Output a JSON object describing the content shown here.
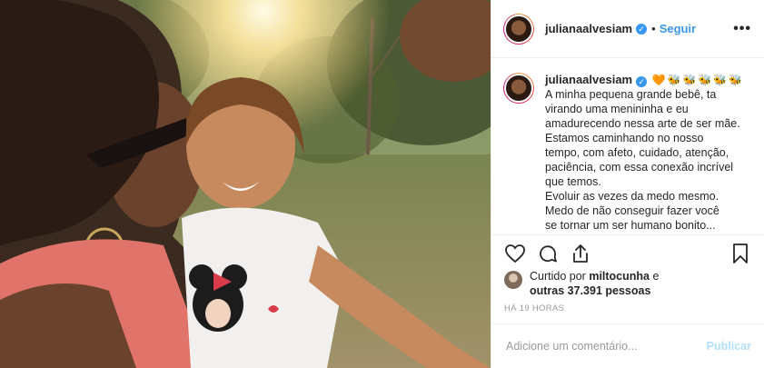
{
  "photo": {
    "alt": ""
  },
  "header": {
    "username": "julianaalvesiam",
    "separator": "•",
    "follow_label": "Seguir",
    "more_icon": "more-horizontal-icon"
  },
  "caption": {
    "username": "julianaalvesiam",
    "emojis": [
      "🧡",
      "🐝",
      "🐝",
      "🐝",
      "🐝",
      "🐝"
    ],
    "lines": [
      "A minha pequena grande bebê, ta",
      "virando uma menininha e eu",
      "amadurecendo nessa arte de ser mãe.",
      "Estamos caminhando no nosso",
      "tempo, com afeto, cuidado, atenção,",
      "paciência, com essa conexão incrível",
      "que temos.",
      "Evoluir as vezes da medo mesmo.",
      "Medo de não conseguir fazer você",
      "se tornar um ser humano bonito..."
    ]
  },
  "actions": {
    "like_icon": "heart-icon",
    "comment_icon": "comment-icon",
    "share_icon": "share-icon",
    "save_icon": "bookmark-icon"
  },
  "likes": {
    "prefix": "Curtido por",
    "user": "miltocunha",
    "conj": "e",
    "others": "outras 37.391 pessoas"
  },
  "timestamp": "HÁ 19 HORAS",
  "comment_box": {
    "placeholder": "Adicione um comentário...",
    "publish_label": "Publicar"
  },
  "colors": {
    "link": "#3897f0",
    "publish_disabled": "#b2dffc"
  }
}
